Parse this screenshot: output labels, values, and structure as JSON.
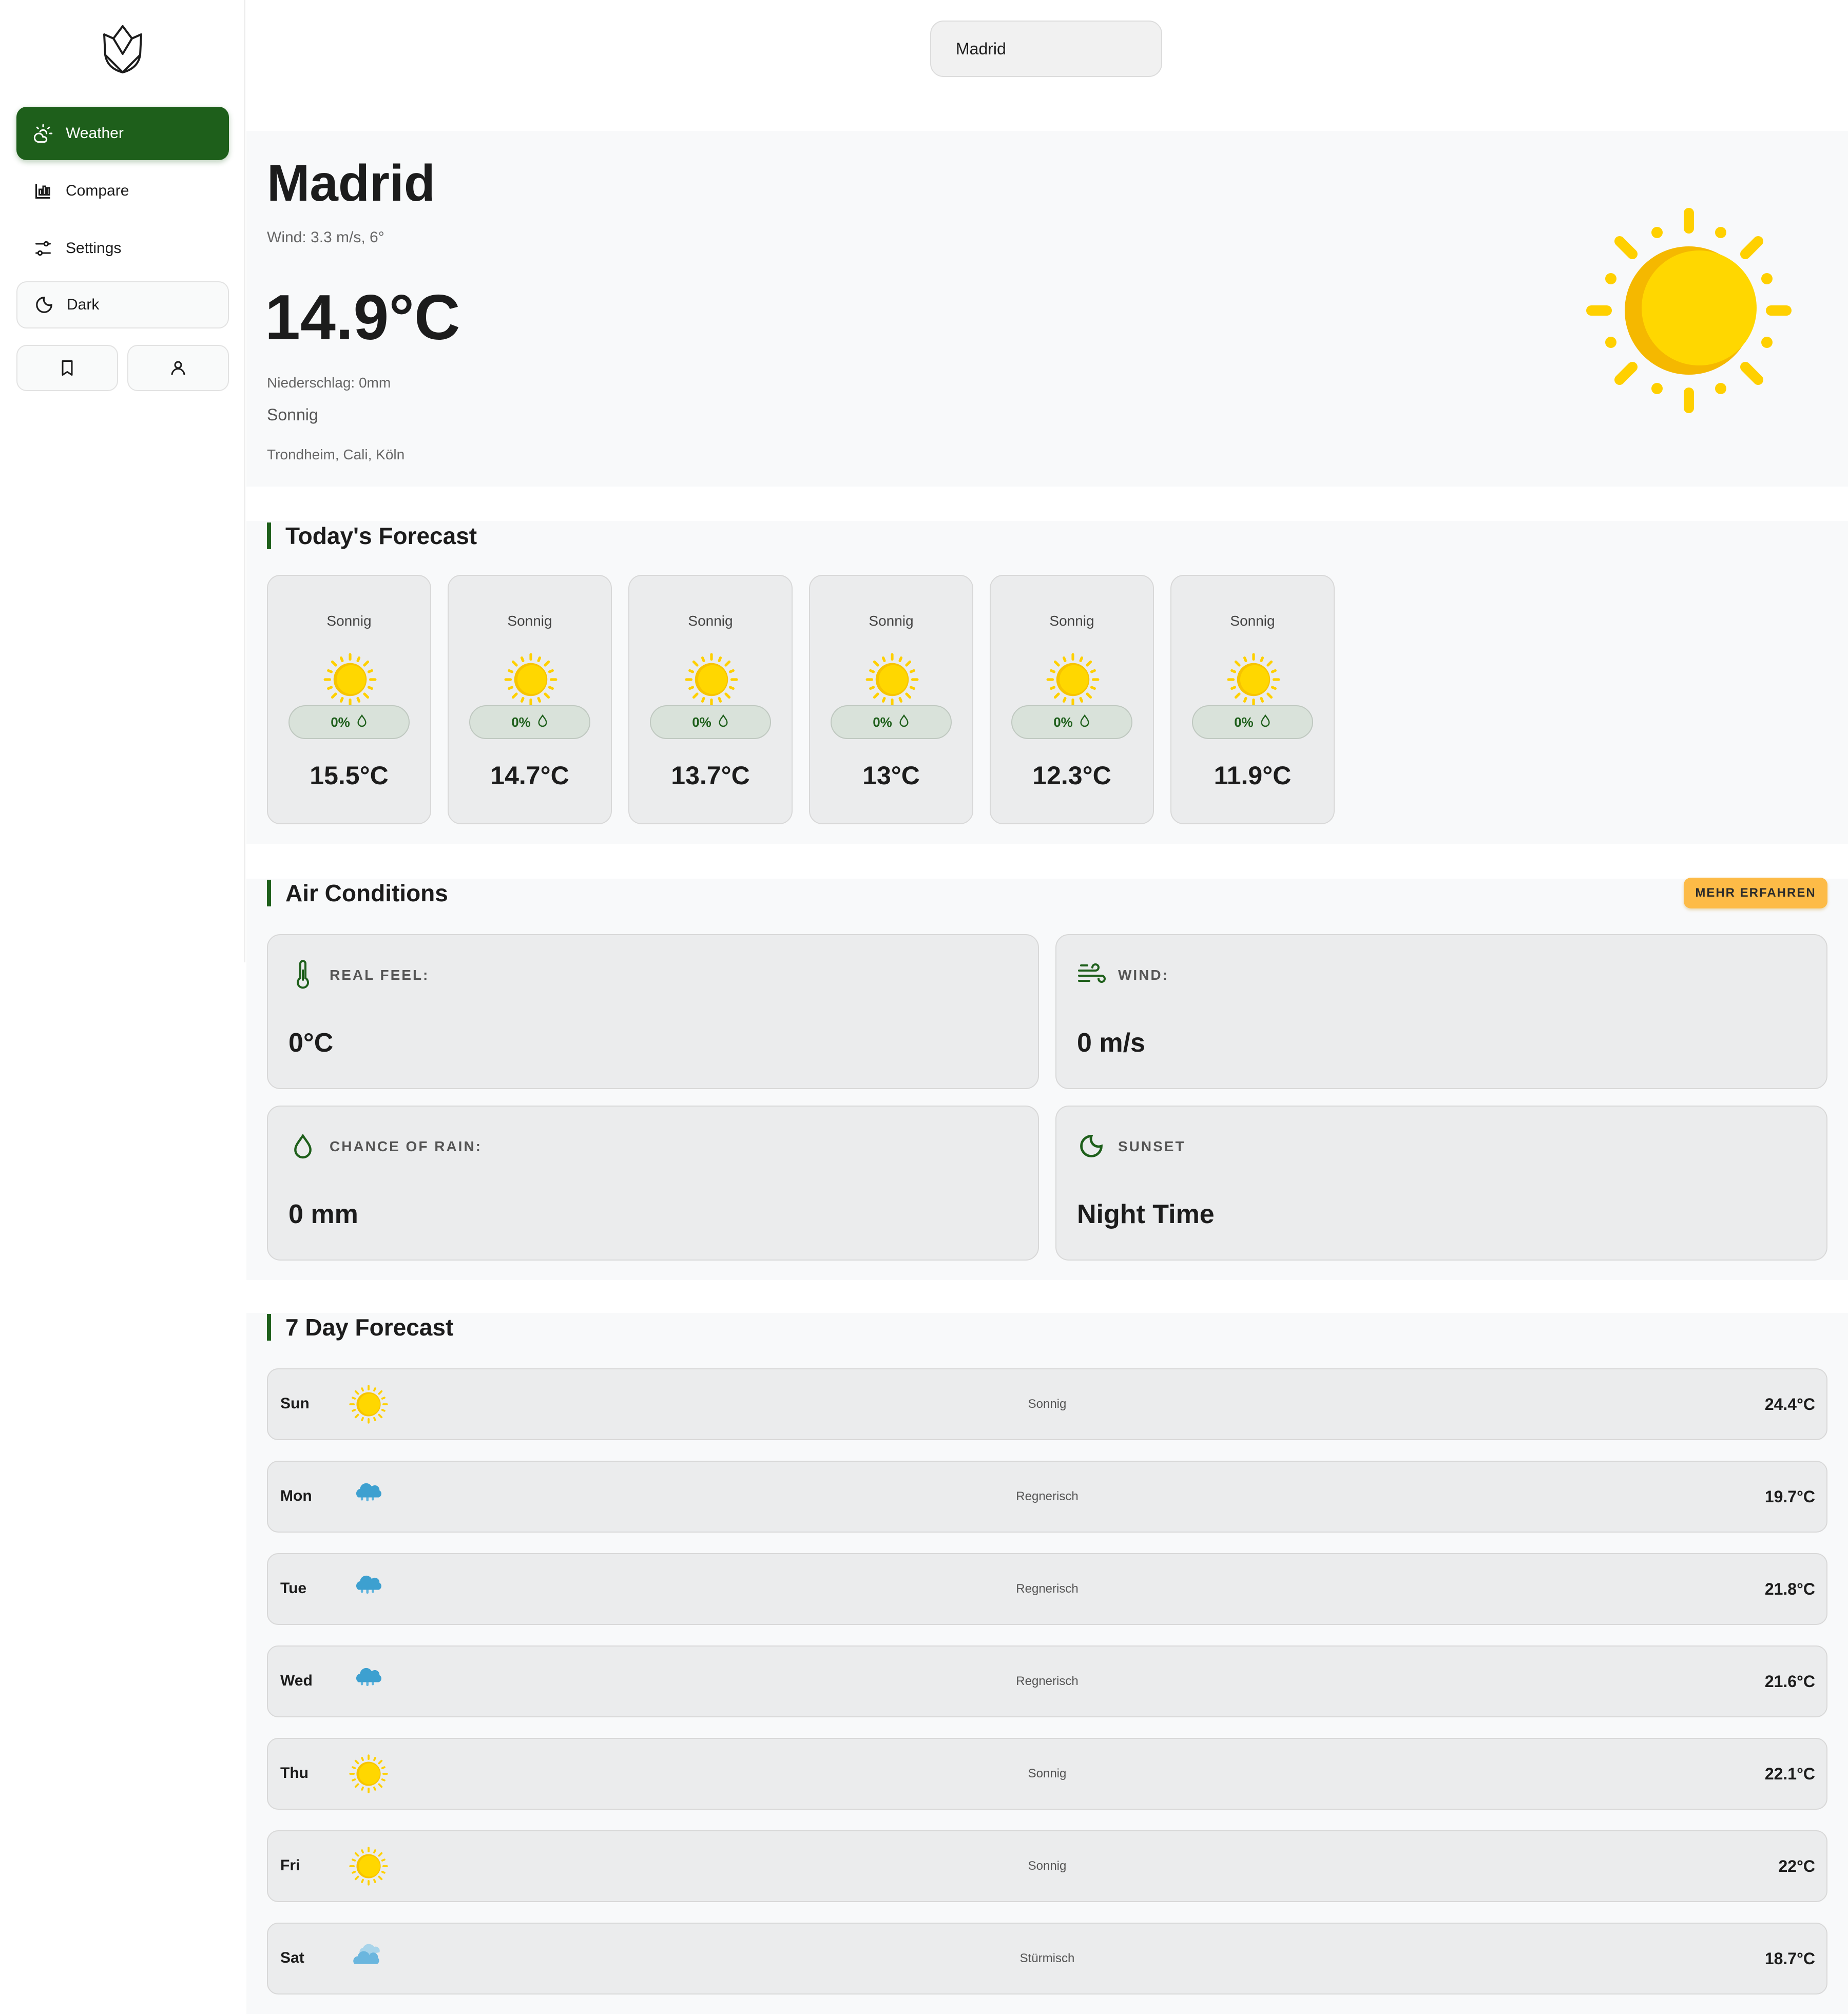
{
  "sidebar": {
    "nav": [
      {
        "label": "Weather",
        "icon": "cloud-sun-icon",
        "active": true
      },
      {
        "label": "Compare",
        "icon": "bar-chart-icon",
        "active": false
      },
      {
        "label": "Settings",
        "icon": "sliders-icon",
        "active": false
      }
    ],
    "theme_toggle": "Dark"
  },
  "search": {
    "value": "Madrid"
  },
  "current": {
    "city": "Madrid",
    "wind": "Wind: 3.3 m/s, 6°",
    "temp": "14.9°C",
    "precip": "Niederschlag: 0mm",
    "condition": "Sonnig",
    "saved_cities": "Trondheim, Cali, Köln"
  },
  "today": {
    "title": "Today's Forecast",
    "hours": [
      {
        "condition": "Sonnig",
        "rain": "0%",
        "temp": "15.5°C"
      },
      {
        "condition": "Sonnig",
        "rain": "0%",
        "temp": "14.7°C"
      },
      {
        "condition": "Sonnig",
        "rain": "0%",
        "temp": "13.7°C"
      },
      {
        "condition": "Sonnig",
        "rain": "0%",
        "temp": "13°C"
      },
      {
        "condition": "Sonnig",
        "rain": "0%",
        "temp": "12.3°C"
      },
      {
        "condition": "Sonnig",
        "rain": "0%",
        "temp": "11.9°C"
      }
    ]
  },
  "air": {
    "title": "Air Conditions",
    "more_label": "MEHR ERFAHREN",
    "cards": [
      {
        "label": "REAL FEEL:",
        "value": "0°C",
        "icon": "thermometer-icon"
      },
      {
        "label": "WIND:",
        "value": "0 m/s",
        "icon": "wind-icon"
      },
      {
        "label": "CHANCE OF RAIN:",
        "value": "0 mm",
        "icon": "droplet-icon"
      },
      {
        "label": "SUNSET",
        "value": "Night Time",
        "icon": "moon-icon"
      }
    ]
  },
  "week": {
    "title": "7 Day Forecast",
    "days": [
      {
        "day": "Sun",
        "condition": "Sonnig",
        "temp": "24.4°C",
        "icon": "sun-icon"
      },
      {
        "day": "Mon",
        "condition": "Regnerisch",
        "temp": "19.7°C",
        "icon": "rain-cloud-icon"
      },
      {
        "day": "Tue",
        "condition": "Regnerisch",
        "temp": "21.8°C",
        "icon": "rain-cloud-icon"
      },
      {
        "day": "Wed",
        "condition": "Regnerisch",
        "temp": "21.6°C",
        "icon": "rain-cloud-icon"
      },
      {
        "day": "Thu",
        "condition": "Sonnig",
        "temp": "22.1°C",
        "icon": "sun-icon"
      },
      {
        "day": "Fri",
        "condition": "Sonnig",
        "temp": "22°C",
        "icon": "sun-icon"
      },
      {
        "day": "Sat",
        "condition": "Stürmisch",
        "temp": "18.7°C",
        "icon": "storm-cloud-icon"
      }
    ]
  },
  "colors": {
    "accent": "#1e5f1b",
    "button_yellow": "#fdbb47",
    "sun": "#ffd700"
  }
}
